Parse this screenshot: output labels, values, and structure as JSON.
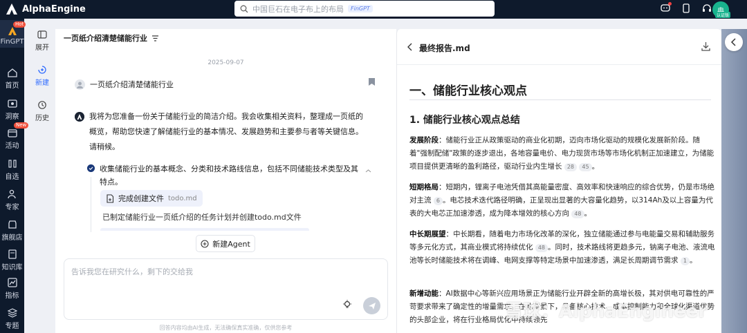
{
  "app": {
    "brand_name": "AlphaEngine"
  },
  "search": {
    "placeholder": "中国巨石在电子布上的布局",
    "tag": "FinGPT"
  },
  "user": {
    "avatar_text": "冉",
    "badge": "认证版"
  },
  "leftnav": {
    "items": [
      {
        "label": "FinGPT",
        "badge": "Hot"
      },
      {
        "label": "首页"
      },
      {
        "label": "洞察"
      },
      {
        "label": "活动",
        "badge": "New"
      },
      {
        "label": "自选"
      },
      {
        "label": "专家"
      },
      {
        "label": "旗舰店"
      },
      {
        "label": "知识库"
      },
      {
        "label": "指标"
      },
      {
        "label": "专题"
      }
    ]
  },
  "subnav": {
    "expand": "展开",
    "new": "新建",
    "history": "历史"
  },
  "chat": {
    "title": "一页纸介绍清楚储能行业",
    "date": "2025-09-07",
    "user_message": "一页纸介绍清楚储能行业",
    "ai_message": "我将为您准备一份关于储能行业的简洁介绍。我会收集相关资料，整理成一页纸的概览，帮助您快速了解储能行业的基本情况、发展趋势和主要参与者等关键信息。请稍候。",
    "step_text": "收集储能行业的基本概念、分类和技术路线信息，包括不同储能技术类型及其特点。",
    "file_action": "完成创建文件",
    "file_name": "todo.md",
    "done_text": "已制定储能行业一页纸介绍的任务计划并创建todo.md文件",
    "new_agent": "新建Agent",
    "input_placeholder": "告诉我您在研究什么，剩下的交给我",
    "disclaimer": "回答内容均由AI生成，无法确保真实准确，仅供您参考"
  },
  "report": {
    "title": "最终报告.md",
    "h1": "一、储能行业核心观点",
    "h2": "1. 储能行业核心观点总结",
    "paragraphs": [
      {
        "label": "发展阶段",
        "text": "：储能行业正从政策驱动的商业化初期，迈向市场化驱动的规模化发展新阶段。随着\"强制配储\"政策的逐步退出，各地容量电价、电力现货市场等市场化机制正加速建立，为储能项目提供更清晰的盈利路径，驱动行业内生增长",
        "cites": [
          "28",
          "45"
        ],
        "tail": "。"
      },
      {
        "label": "短期格局",
        "text": "：短期内，锂离子电池凭借其高能量密度、高效率和快速响应的综合优势，仍是市场绝对主流",
        "cites": [
          "6"
        ],
        "tail": "。电芯技术迭代路径明确，正呈现出显著的大容量化趋势，以314Ah及以上容量为代表的大电芯正加速渗透，成为降本增效的核心方向",
        "cites2": [
          "48"
        ],
        "tail2": "。"
      },
      {
        "label": "中长期展望",
        "text": "：中长期看，随着电力市场化改革的深化，独立储能通过参与电能量交易和辅助服务等多元化方式，其商业模式将持续优化",
        "cites": [
          "48"
        ],
        "tail": "。同时，技术路线将更趋多元，钠离子电池、液流电池等长时储能技术将在调峰、电网支撑等特定场景中加速渗透，满足长周期调节需求",
        "cites2": [
          "1"
        ],
        "tail2": "。"
      },
      {
        "label": "新增动能",
        "text": "：AI数据中心等新兴应用场景正为储能行业开辟全新的高增长极，其对供电可靠性的严苛要求带来了确定性的增量需求。在此背景下，具备核心技术、成本控制能力和全球化渠道优势的头部企业，将在行业格局优化中持续领先"
      }
    ]
  },
  "watermark": "雪球：AlphaEngineer"
}
